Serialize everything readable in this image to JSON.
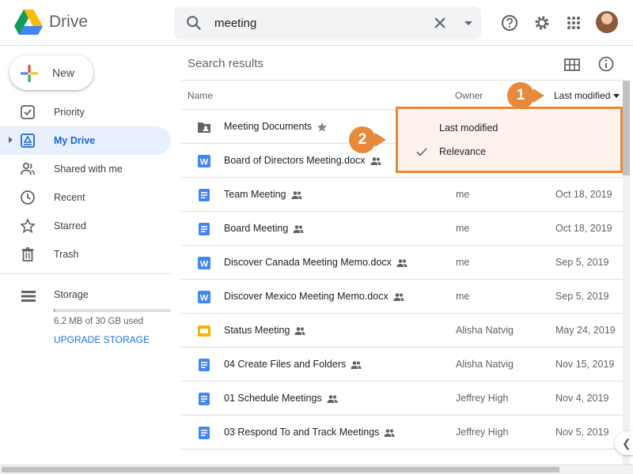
{
  "app": {
    "name": "Drive"
  },
  "search": {
    "value": "meeting"
  },
  "sidebar": {
    "new_label": "New",
    "items": [
      {
        "label": "Priority",
        "icon": "priority-icon",
        "active": false
      },
      {
        "label": "My Drive",
        "icon": "my-drive-icon",
        "active": true
      },
      {
        "label": "Shared with me",
        "icon": "shared-with-me-icon",
        "active": false
      },
      {
        "label": "Recent",
        "icon": "clock-icon",
        "active": false
      },
      {
        "label": "Starred",
        "icon": "star-icon",
        "active": false
      },
      {
        "label": "Trash",
        "icon": "trash-icon",
        "active": false
      }
    ],
    "storage": {
      "label": "Storage",
      "used_text": "6.2 MB of 30 GB used",
      "used_fraction": 0.0002,
      "upgrade_label": "UPGRADE STORAGE"
    }
  },
  "main": {
    "title": "Search results",
    "columns": {
      "name": "Name",
      "owner": "Owner",
      "modified": "Last modified"
    },
    "files": [
      {
        "name": "Meeting Documents",
        "type": "folder",
        "owner": "",
        "modified": "",
        "shared": false,
        "starred": true
      },
      {
        "name": "Board of Directors Meeting.docx",
        "type": "word",
        "owner": "",
        "modified": "",
        "shared": true,
        "starred": false
      },
      {
        "name": "Team Meeting",
        "type": "doc",
        "owner": "me",
        "modified": "Oct 18, 2019",
        "shared": true,
        "starred": false
      },
      {
        "name": "Board Meeting",
        "type": "doc",
        "owner": "me",
        "modified": "Oct 18, 2019",
        "shared": true,
        "starred": false
      },
      {
        "name": "Discover Canada Meeting Memo.docx",
        "type": "word",
        "owner": "me",
        "modified": "Sep 5, 2019",
        "shared": true,
        "starred": false
      },
      {
        "name": "Discover Mexico Meeting Memo.docx",
        "type": "word",
        "owner": "me",
        "modified": "Sep 5, 2019",
        "shared": true,
        "starred": false
      },
      {
        "name": "Status Meeting",
        "type": "slides",
        "owner": "Alisha Natvig",
        "modified": "May 24, 2019",
        "shared": true,
        "starred": false
      },
      {
        "name": "04 Create Files and Folders",
        "type": "doc",
        "owner": "Alisha Natvig",
        "modified": "Nov 15, 2019",
        "shared": true,
        "starred": false
      },
      {
        "name": "01 Schedule Meetings",
        "type": "doc",
        "owner": "Jeffrey High",
        "modified": "Nov 4, 2019",
        "shared": true,
        "starred": false
      },
      {
        "name": "03 Respond To and Track Meetings",
        "type": "doc",
        "owner": "Jeffrey High",
        "modified": "Nov 5, 2019",
        "shared": true,
        "starred": false
      }
    ]
  },
  "sort_menu": {
    "items": [
      {
        "label": "Last modified",
        "checked": false
      },
      {
        "label": "Relevance",
        "checked": true
      }
    ]
  },
  "callouts": [
    "1",
    "2"
  ],
  "colors": {
    "accent": "#1a73e8",
    "callout": "#e8883a",
    "active_nav_bg": "#e8f0fe",
    "doc_blue": "#4285f4",
    "slides_yellow": "#f4b400"
  }
}
